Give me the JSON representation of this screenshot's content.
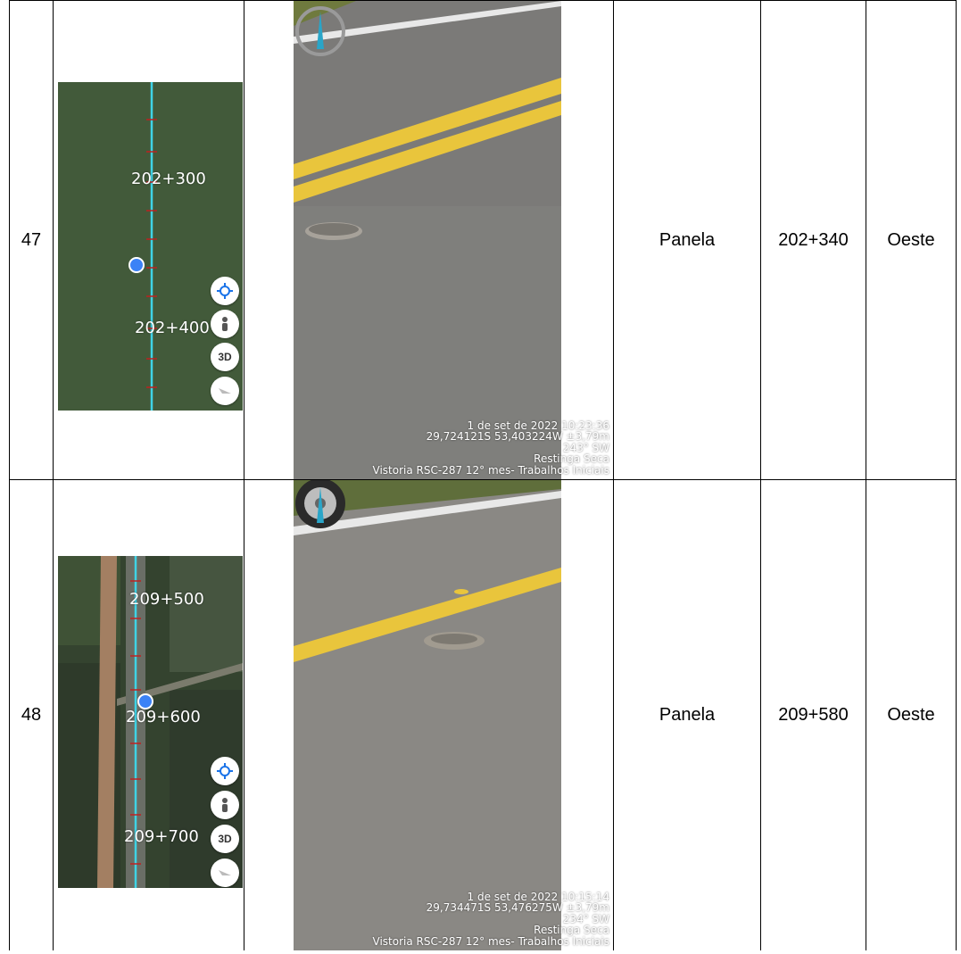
{
  "rows": [
    {
      "number": "47",
      "map": {
        "labels": [
          "202+300",
          "202+400"
        ],
        "buttons": [
          "3D"
        ]
      },
      "photo": {
        "stamp": [
          "1 de set de 2022 10:23:36",
          "29,724121S 53,403224W ±3,79m",
          "243° SW",
          "Restinga Seca",
          "Vistoria RSC-287 12° mes- Trabalhos Iniciais"
        ]
      },
      "defect": "Panela",
      "km": "202+340",
      "direction": "Oeste"
    },
    {
      "number": "48",
      "map": {
        "labels": [
          "209+500",
          "209+600",
          "209+700"
        ],
        "buttons": [
          "3D"
        ]
      },
      "photo": {
        "stamp": [
          "1 de set de 2022 10:15:14",
          "29,734471S 53,476275W ±3,79m",
          "234° SW",
          "Restinga Seca",
          "Vistoria RSC-287 12° mes- Trabalhos Iniciais"
        ]
      },
      "defect": "Panela",
      "km": "209+580",
      "direction": "Oeste"
    }
  ]
}
